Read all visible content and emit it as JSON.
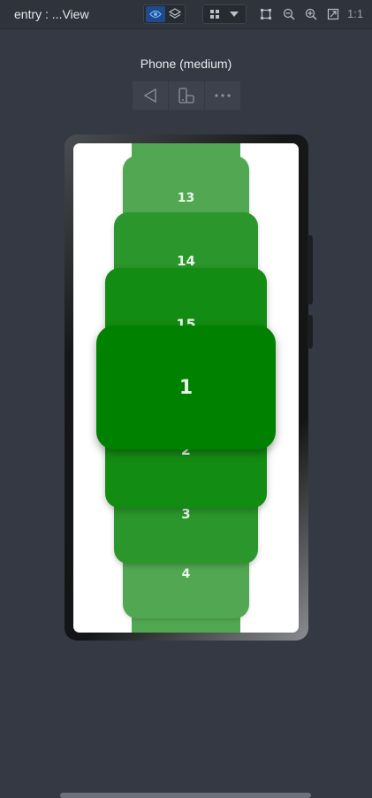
{
  "window": {
    "title": "entry : ...View",
    "zoom_ratio_label": "1:1"
  },
  "toolbar": {
    "icons": [
      "eye-icon",
      "layers-icon",
      "grid-icon",
      "chevron-down-icon",
      "crop-icon",
      "zoom-out-icon",
      "zoom-in-icon",
      "fit-screen-icon"
    ]
  },
  "device": {
    "label": "Phone (medium)",
    "controls": [
      "back-icon",
      "rotate-device-icon",
      "more-icon"
    ]
  },
  "list": {
    "items": [
      {
        "label": "13"
      },
      {
        "label": "14"
      },
      {
        "label": "15"
      },
      {
        "label": "1"
      },
      {
        "label": "2"
      },
      {
        "label": "3"
      },
      {
        "label": "4"
      }
    ]
  },
  "colors": {
    "accent": "#008200",
    "background": "#343943",
    "selected_icon": "#3a86ff"
  }
}
